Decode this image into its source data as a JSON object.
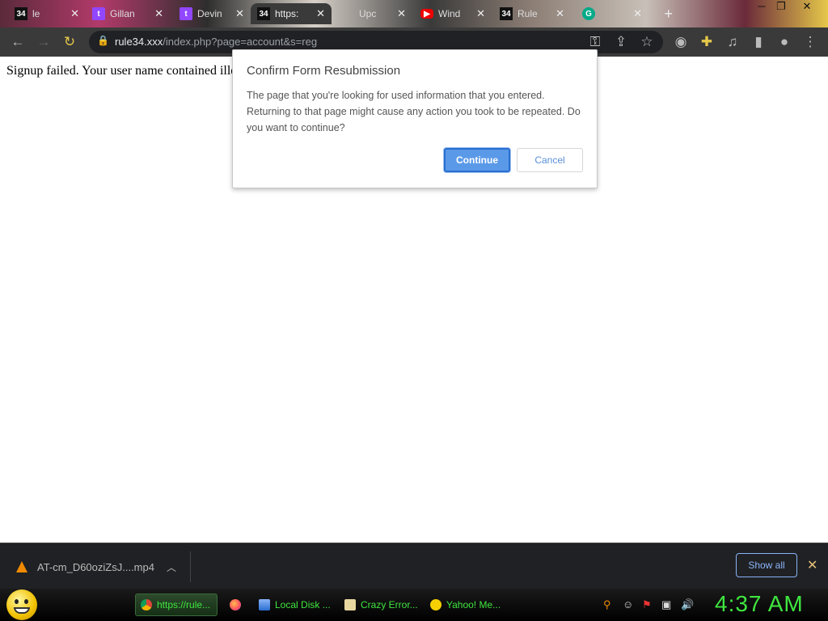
{
  "tabs": [
    {
      "title": "le",
      "icon": "rule34-icon"
    },
    {
      "title": "Gillan",
      "icon": "twitch-icon"
    },
    {
      "title": "Devin",
      "icon": "twitch-icon"
    },
    {
      "title": "https:",
      "icon": "rule34-icon",
      "active": true
    },
    {
      "title": "Upc",
      "icon": "microsoft-icon"
    },
    {
      "title": "Wind",
      "icon": "youtube-icon"
    },
    {
      "title": "Rule",
      "icon": "rule34-icon"
    }
  ],
  "toolbar": {
    "url_host": "rule34.xxx",
    "url_path": "/index.php?page=account&s=reg"
  },
  "page": {
    "message": "Signup failed. Your user name contained illegal characters."
  },
  "dialog": {
    "title": "Confirm Form Resubmission",
    "body": "The page that you're looking for used information that you entered. Returning to that page might cause any action you took to be repeated. Do you want to continue?",
    "continue_label": "Continue",
    "cancel_label": "Cancel"
  },
  "downloads": {
    "file_name": "AT-cm_D60oziZsJ....mp4",
    "show_all_label": "Show all"
  },
  "taskbar": {
    "items": [
      {
        "label": "https://rule...",
        "icon": "chrome-icon",
        "active": true
      },
      {
        "label": "",
        "icon": "firefox-icon"
      },
      {
        "label": "Local Disk ...",
        "icon": "drive-icon"
      },
      {
        "label": "Crazy Error...",
        "icon": "document-icon"
      },
      {
        "label": "Yahoo! Me...",
        "icon": "yahoo-messenger-icon"
      }
    ],
    "clock": "4:37 AM"
  },
  "colors": {
    "accent": "#5a99e8",
    "taskbar_text": "#3fe63f",
    "toolbar": "#3a3a3a"
  }
}
